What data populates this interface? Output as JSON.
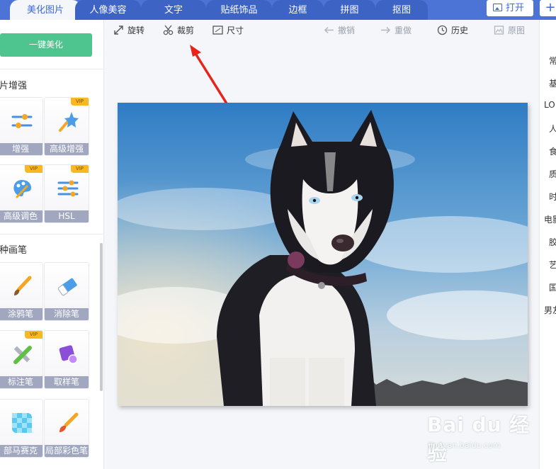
{
  "tabs": [
    {
      "label": "美化图片",
      "active": true
    },
    {
      "label": "人像美容",
      "active": false
    },
    {
      "label": "文字",
      "active": false
    },
    {
      "label": "贴纸饰品",
      "active": false
    },
    {
      "label": "边框",
      "active": false
    },
    {
      "label": "拼图",
      "active": false
    },
    {
      "label": "抠图",
      "active": false
    }
  ],
  "top_actions": {
    "open_label": "打开",
    "plus_label": "+"
  },
  "left_panel": {
    "one_key_label": "一键美化",
    "section_enhance": "片增强",
    "section_brush": "种画笔",
    "vip_badge": "VIP",
    "tools": [
      {
        "label": "增强",
        "icon": "sliders-icon",
        "vip": false
      },
      {
        "label": "高级增强",
        "icon": "magic-star-icon",
        "vip": true
      },
      {
        "label": "高级调色",
        "icon": "palette-icon",
        "vip": true
      },
      {
        "label": "HSL",
        "icon": "hsl-sliders-icon",
        "vip": true
      },
      {
        "label": "涂鸦笔",
        "icon": "brush-icon",
        "vip": false
      },
      {
        "label": "消除笔",
        "icon": "eraser-icon",
        "vip": false
      },
      {
        "label": "标注笔",
        "icon": "marker-pen-icon",
        "vip": true
      },
      {
        "label": "取样笔",
        "icon": "sample-pen-icon",
        "vip": false
      },
      {
        "label": "部马赛克",
        "icon": "mosaic-icon",
        "vip": false
      },
      {
        "label": "局部彩色笔",
        "icon": "color-brush-icon",
        "vip": false
      }
    ]
  },
  "toolbar": {
    "rotate_label": "旋转",
    "crop_label": "裁剪",
    "size_label": "尺寸",
    "undo_label": "撤销",
    "redo_label": "重做",
    "history_label": "历史",
    "original_label": "原图"
  },
  "right_panel": {
    "items": [
      "常",
      "基",
      "LO",
      "人",
      "食",
      "质",
      "时",
      "电影",
      "胶",
      "艺",
      "国",
      "男友"
    ]
  },
  "watermark": {
    "main": "Bai du 经验",
    "sub": "jingyan.baidu.com"
  },
  "colors": {
    "brand_blue": "#4b74d6",
    "tab_blue": "#3d63c4",
    "onekey_green": "#4ec58e",
    "vip_gold": "#f6b921",
    "annotation_red": "#e8231c"
  }
}
